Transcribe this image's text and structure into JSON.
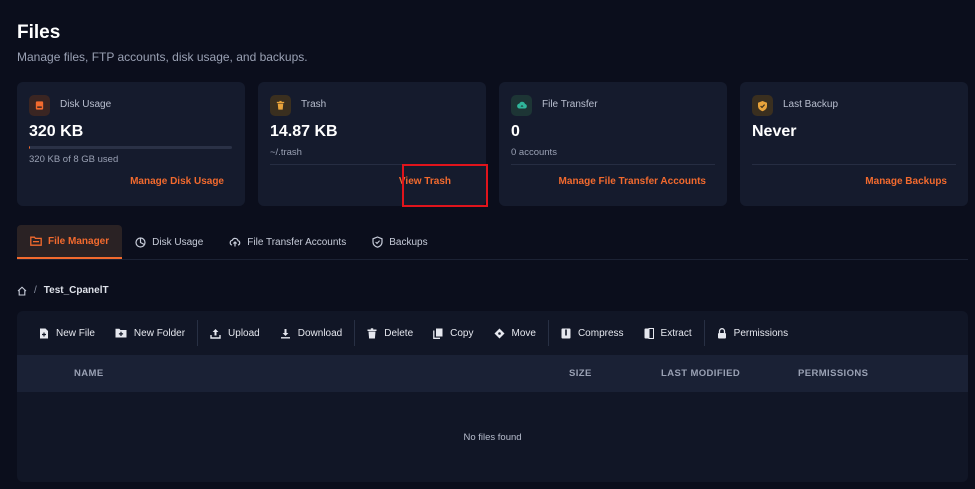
{
  "page": {
    "title": "Files",
    "subtitle": "Manage files, FTP accounts, disk usage, and backups."
  },
  "cards": {
    "disk": {
      "label": "Disk Usage",
      "value": "320 KB",
      "sub": "320 KB of 8 GB used",
      "action": "Manage Disk Usage",
      "usage_fraction": 0.0001,
      "icon": "storage-icon",
      "icon_color": "#f26a2e"
    },
    "trash": {
      "label": "Trash",
      "value": "14.87 KB",
      "sub": "~/.trash",
      "action": "View Trash",
      "icon": "trash-icon",
      "icon_color": "#e8a33b"
    },
    "transfer": {
      "label": "File Transfer",
      "value": "0",
      "sub": "0 accounts",
      "action": "Manage File Transfer Accounts",
      "icon": "cloud-upload-icon",
      "icon_color": "#2fb59a"
    },
    "backup": {
      "label": "Last Backup",
      "value": "Never",
      "action": "Manage Backups",
      "icon": "shield-icon",
      "icon_color": "#e8a33b"
    }
  },
  "tabs": [
    {
      "label": "File Manager",
      "icon": "folder-icon",
      "active": true
    },
    {
      "label": "Disk Usage",
      "icon": "pie-chart-icon",
      "active": false
    },
    {
      "label": "File Transfer Accounts",
      "icon": "cloud-upload-icon",
      "active": false
    },
    {
      "label": "Backups",
      "icon": "shield-icon",
      "active": false
    }
  ],
  "breadcrumb": {
    "home_icon": "home-icon",
    "separator": "/",
    "current": "Test_CpanelT"
  },
  "toolbar": {
    "new_file": "New File",
    "new_folder": "New Folder",
    "upload": "Upload",
    "download": "Download",
    "delete": "Delete",
    "copy": "Copy",
    "move": "Move",
    "compress": "Compress",
    "extract": "Extract",
    "permissions": "Permissions"
  },
  "table": {
    "columns": [
      "NAME",
      "SIZE",
      "LAST MODIFIED",
      "PERMISSIONS"
    ],
    "empty_message": "No files found"
  },
  "colors": {
    "accent": "#f26a2e",
    "background": "#0b0e1c",
    "card": "#151b2d",
    "highlight": "#e0141c"
  }
}
